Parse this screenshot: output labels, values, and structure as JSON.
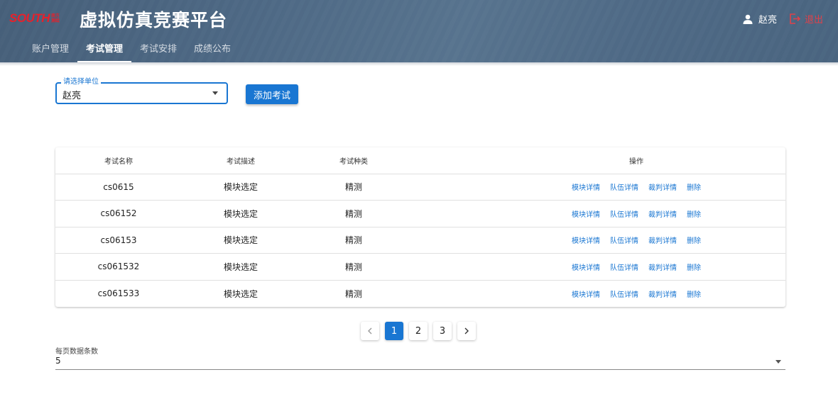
{
  "header": {
    "logo_text": "SOUTH",
    "logo_sub": "南方测绘",
    "title": "虚拟仿真竞赛平台",
    "user_name": "赵亮",
    "logout_label": "退出",
    "nav_tabs": [
      {
        "label": "账户管理",
        "active": false
      },
      {
        "label": "考试管理",
        "active": true
      },
      {
        "label": "考试安排",
        "active": false
      },
      {
        "label": "成绩公布",
        "active": false
      }
    ]
  },
  "filter": {
    "legend": "请选择单位",
    "value": "赵亮"
  },
  "add_button_label": "添加考试",
  "table": {
    "headers": [
      "考试名称",
      "考试描述",
      "考试种类",
      "操作"
    ],
    "rows": [
      {
        "name": "cs0615",
        "desc": "模块选定",
        "type": "精测"
      },
      {
        "name": "cs06152",
        "desc": "模块选定",
        "type": "精测"
      },
      {
        "name": "cs06153",
        "desc": "模块选定",
        "type": "精测"
      },
      {
        "name": "cs061532",
        "desc": "模块选定",
        "type": "精测"
      },
      {
        "name": "cs061533",
        "desc": "模块选定",
        "type": "精测"
      }
    ],
    "actions": [
      "模块详情",
      "队伍详情",
      "裁判详情",
      "删除"
    ]
  },
  "pagination": {
    "prev_icon": "chevron-left-icon",
    "next_icon": "chevron-right-icon",
    "pages": [
      "1",
      "2",
      "3"
    ],
    "current": "1"
  },
  "per_page": {
    "label": "每页数据条数",
    "value": "5"
  },
  "colors": {
    "primary": "#1976d2",
    "header_bg": "#4e6985",
    "logout": "#e0414a",
    "logo": "#e8202a"
  }
}
